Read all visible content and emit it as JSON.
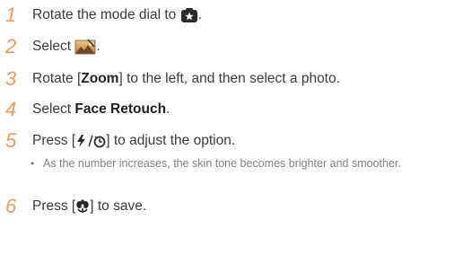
{
  "steps": [
    {
      "number": "1",
      "text_before": "Rotate the mode dial to",
      "icon": "magic-plus-mode-icon",
      "text_after": "."
    },
    {
      "number": "2",
      "text_before": "Select",
      "icon": "photo-editor-icon",
      "text_after": "."
    },
    {
      "number": "3",
      "text_before": "Rotate [",
      "bold": "Zoom",
      "text_after": "] to the left, and then select a photo."
    },
    {
      "number": "4",
      "text_before": "Select",
      "bold": "Face Retouch",
      "text_after": "."
    },
    {
      "number": "5",
      "text_before": "Press [",
      "icon_text": "⚡/⏲",
      "text_after": "] to adjust the option."
    },
    {
      "number": "6",
      "text_before": "Press [",
      "icon": "macro-icon",
      "text_after": "] to save."
    }
  ],
  "bullet": {
    "symbol": "•",
    "text": "As the number increases, the skin tone becomes brighter and smoother."
  },
  "colors": {
    "step_number": "#ea9a5a",
    "body_text": "#3a3a3a",
    "bullet_text": "#808080"
  }
}
